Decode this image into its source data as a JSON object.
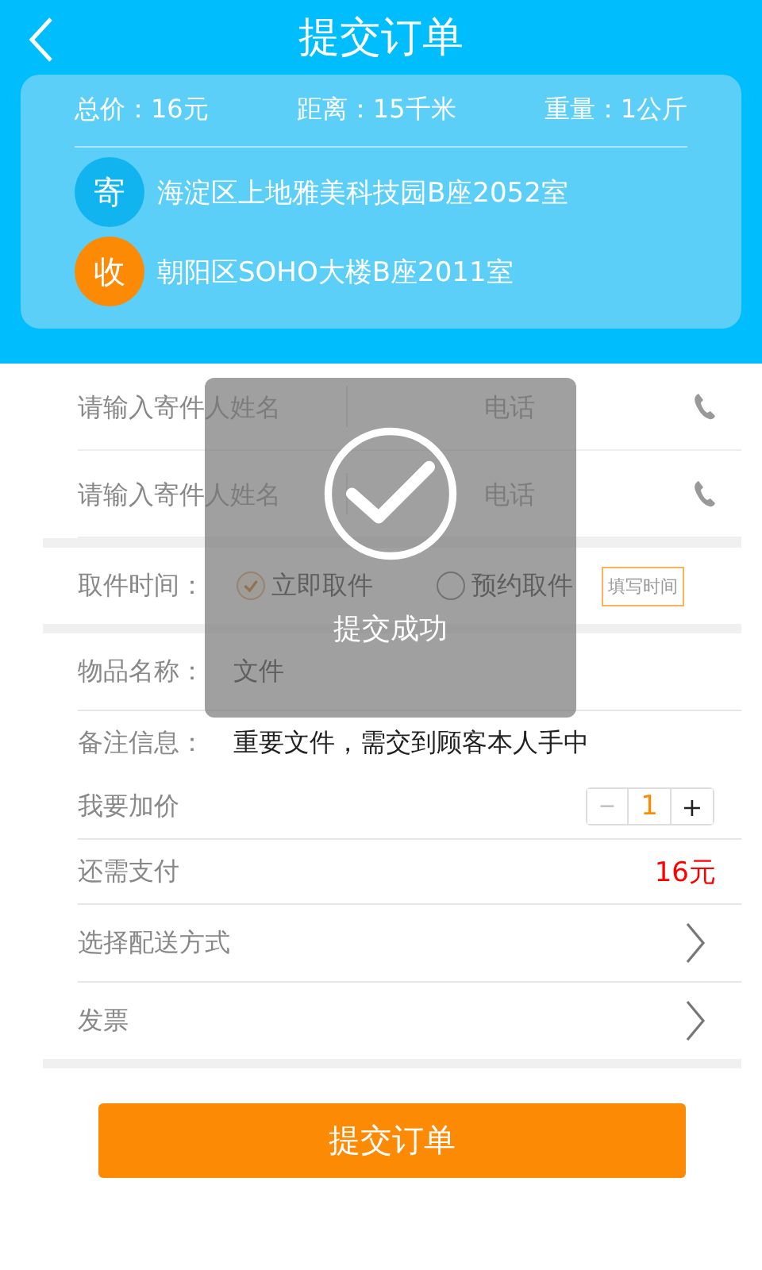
{
  "header": {
    "title": "提交订单"
  },
  "summary": {
    "stats": [
      "总价：16元",
      "距离：15千米",
      "重量：1公斤"
    ],
    "addresses": [
      {
        "badge": "寄",
        "text": "海淀区上地雅美科技园B座2052室",
        "color": "#12b4f0"
      },
      {
        "badge": "收",
        "text": "朝阳区SOHO大楼B座2011室",
        "color": "#fc8a05"
      }
    ]
  },
  "contacts": [
    {
      "name_placeholder": "请输入寄件人姓名",
      "phone_placeholder": "电话"
    },
    {
      "name_placeholder": "请输入寄件人姓名",
      "phone_placeholder": "电话"
    }
  ],
  "pickup": {
    "label": "取件时间：",
    "options": [
      {
        "label": "立即取件",
        "selected": true
      },
      {
        "label": "预约取件",
        "selected": false
      }
    ],
    "time_button": "填写时间"
  },
  "item": {
    "label": "物品名称：",
    "value": "文件"
  },
  "notes": {
    "label": "备注信息：",
    "value": "重要文件，需交到顾客本人手中"
  },
  "markup": {
    "label": "我要加价",
    "minus": "−",
    "value": "1",
    "plus": "+"
  },
  "payment": {
    "label": "还需支付",
    "value": "16元"
  },
  "links": [
    "选择配送方式",
    "发票"
  ],
  "submit": "提交订单",
  "toast": {
    "message": "提交成功"
  }
}
